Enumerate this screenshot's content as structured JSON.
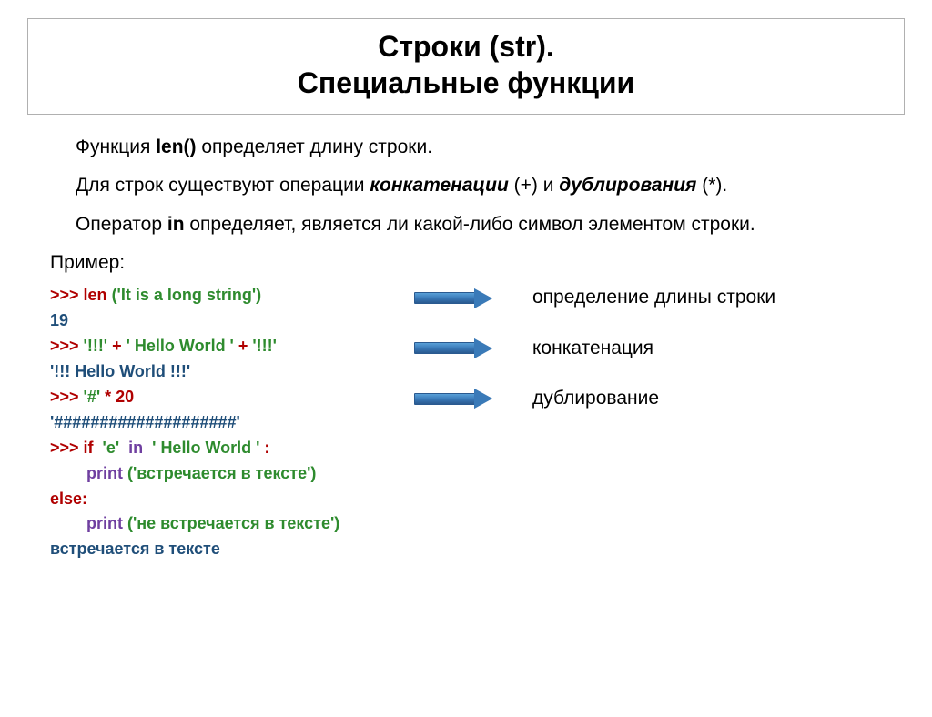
{
  "title": {
    "line1": "Строки (str).",
    "line2": "Специальные функции"
  },
  "para1": {
    "t1": "Функция ",
    "b1": "len()",
    "t2": " определяет длину строки."
  },
  "para2": {
    "t1": "Для строк существуют операции ",
    "bi1": "конкатенации",
    "t2": " (+) и ",
    "bi2": "дублирования",
    "t3": " (*)."
  },
  "para3": {
    "t1": "Оператор ",
    "b1": "in",
    "t2": " определяет, является ли какой-либо символ элементом строки."
  },
  "example_label": "Пример:",
  "code": {
    "l1": {
      "prompt": ">>> ",
      "fn": "len ",
      "arg": "('It is a long string')"
    },
    "l2": "19",
    "l3": {
      "prompt": ">>> ",
      "s1": "'!!!'",
      "plus1": " + ",
      "s2": "' Hello World '",
      "plus2": " + ",
      "s3": "'!!!'"
    },
    "l4": "'!!! Hello World !!!'",
    "l5": {
      "prompt": ">>> ",
      "s1": "'#'",
      "op": " * ",
      "n": "20"
    },
    "l6": "'####################'",
    "l7": {
      "prompt": ">>> ",
      "kw": "if  ",
      "s1": "'e'",
      "sp1": "  ",
      "in": "in",
      "sp2": "  ",
      "s2": "' Hello World '",
      "colon": " :"
    },
    "l8": {
      "indent": "        ",
      "fn": "print ",
      "arg": "('встречается в тексте')"
    },
    "l9": "else",
    "l9c": ":",
    "l10": {
      "indent": "        ",
      "fn": "print ",
      "arg": "('не встречается в тексте')"
    },
    "l11": "встречается в тексте"
  },
  "annotations": {
    "a1": "определение длины строки",
    "a2": "конкатенация",
    "a3": "дублирование"
  }
}
